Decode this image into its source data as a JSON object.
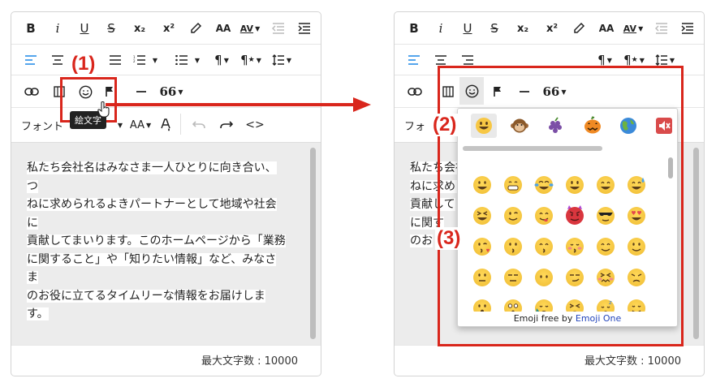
{
  "toolbar": {
    "bold": "B",
    "italic": "i",
    "underline": "U",
    "strike": "S",
    "subscript": "x₂",
    "superscript": "x²",
    "font_label": "フォント",
    "font_label_cut": "フォ",
    "font_size_label": "AA",
    "char_spacing_label": "AV",
    "paragraph": "¶",
    "paragraph_style": "¶",
    "quote": "66"
  },
  "editor": {
    "lines": [
      "私たち会社名はみなさま一人ひとりに向き合い、つ",
      "ねに求められるよきパートナーとして地域や社会に",
      "貢献してまいります。このホームページから「業務",
      "に関すること」や「知りたい情報」など、みなさま",
      "のお役に立てるタイムリーな情報をお届けします。"
    ],
    "partial_lines": [
      "私たち会社",
      "ねに求められ",
      "貢献して",
      "に関す",
      "のお"
    ],
    "counter": "最大文字数 : 10000"
  },
  "tooltip": "絵文字",
  "labels": {
    "step1": "(1)",
    "step2": "(2)",
    "step3": "(3)"
  },
  "emoji_picker": {
    "categories": [
      "smileys",
      "animals",
      "food",
      "activities",
      "travel",
      "symbols"
    ],
    "footer_prefix": "Emoji free by ",
    "footer_link": "Emoji One"
  },
  "colors": {
    "accent_red": "#d9261c",
    "blue_align": "#1e88e5",
    "emoji_yellow": "#f7c744"
  }
}
